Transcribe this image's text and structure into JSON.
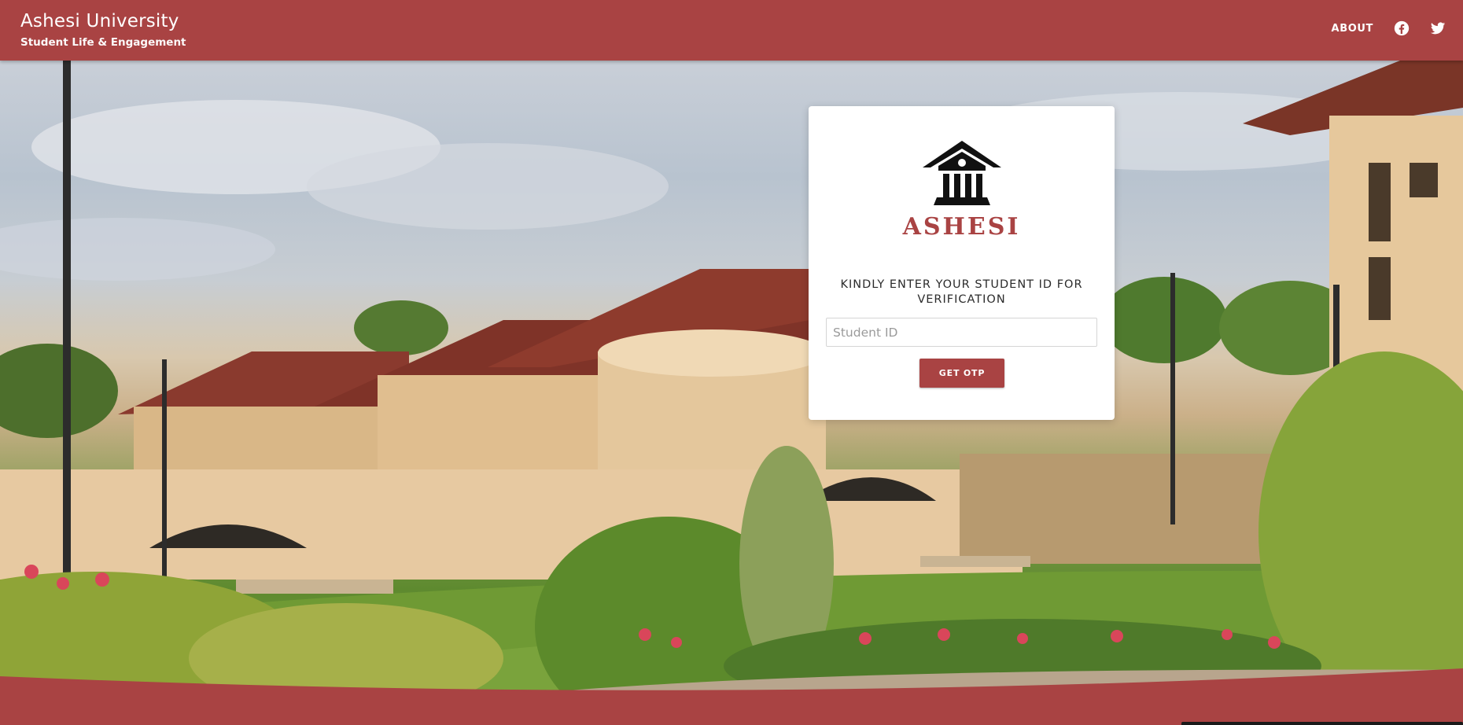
{
  "header": {
    "title": "Ashesi University",
    "subtitle": "Student Life & Engagement",
    "nav": {
      "about_label": "ABOUT",
      "facebook_icon": "facebook-icon",
      "twitter_icon": "twitter-icon"
    }
  },
  "login_card": {
    "logo_text": "ASHESI",
    "logo_icon": "ashesi-building-icon",
    "prompt": "KINDLY ENTER YOUR STUDENT ID FOR VERIFICATION",
    "student_id": {
      "value": "",
      "placeholder": "Student ID"
    },
    "submit_label": "GET OTP"
  },
  "colors": {
    "brand": "#a94343",
    "card_bg": "#ffffff",
    "header_text": "#ffffff"
  }
}
